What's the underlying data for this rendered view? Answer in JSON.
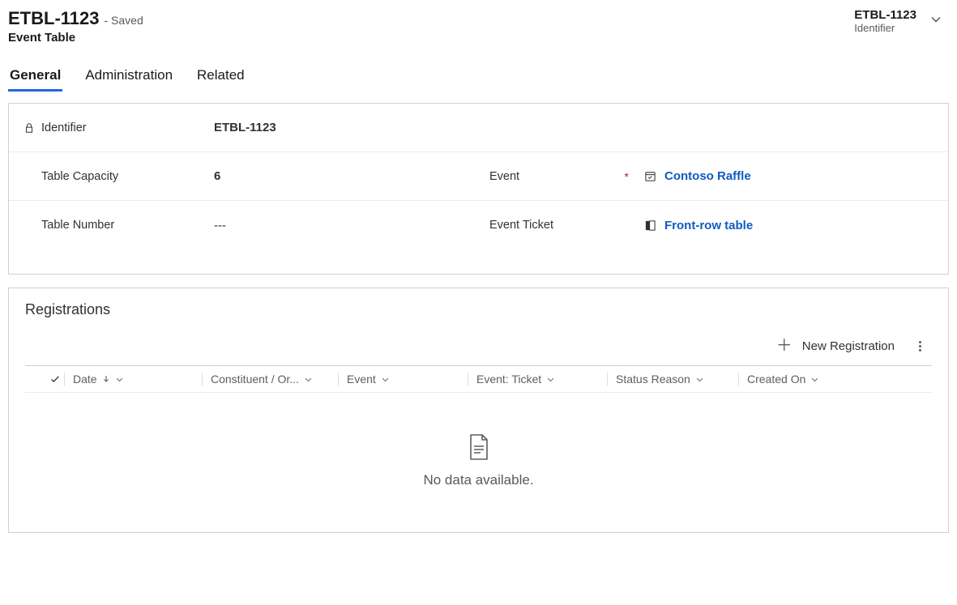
{
  "header": {
    "title": "ETBL-1123",
    "state": "- Saved",
    "subtitle": "Event Table",
    "selector": {
      "title": "ETBL-1123",
      "sub": "Identifier"
    }
  },
  "tabs": [
    "General",
    "Administration",
    "Related"
  ],
  "activeTab": 0,
  "form": {
    "identifier": {
      "label": "Identifier",
      "value": "ETBL-1123"
    },
    "capacity": {
      "label": "Table Capacity",
      "value": "6"
    },
    "number": {
      "label": "Table Number",
      "value": "---"
    },
    "event": {
      "label": "Event",
      "value": "Contoso Raffle",
      "required": true
    },
    "ticket": {
      "label": "Event Ticket",
      "value": "Front-row table"
    }
  },
  "registrations": {
    "title": "Registrations",
    "newButton": "New Registration",
    "columns": [
      "Date",
      "Constituent / Or...",
      "Event",
      "Event: Ticket",
      "Status Reason",
      "Created On"
    ],
    "empty": "No data available."
  }
}
